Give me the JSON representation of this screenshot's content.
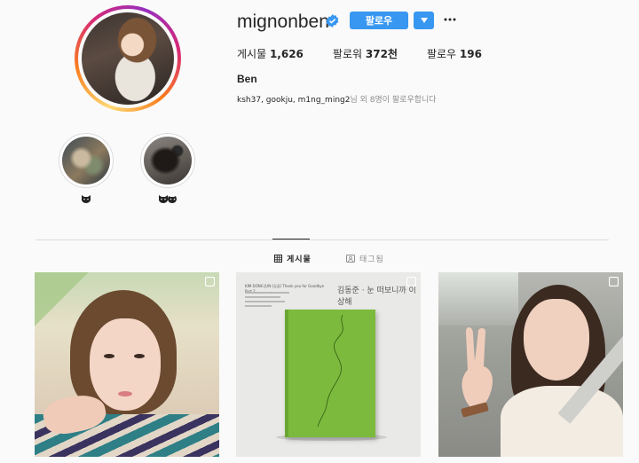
{
  "profile": {
    "username": "mignonben",
    "verified": true,
    "follow_label": "팔로우",
    "full_name": "Ben"
  },
  "stats": {
    "posts_label": "게시물",
    "posts_value": "1,626",
    "followers_label": "팔로워",
    "followers_value": "372천",
    "following_label": "팔로우",
    "following_value": "196"
  },
  "followed_by": {
    "names": "ksh37, gookju, m1ng_ming2",
    "suffix": "님 외 8명이 팔로우합니다"
  },
  "highlights": [
    {
      "label_icon": "cat-face-emoji"
    },
    {
      "label_icon": "cat-and-dog-face-emoji"
    }
  ],
  "tabs": {
    "posts_label": "게시물",
    "tagged_label": "태그됨"
  },
  "posts": [
    {
      "type": "photo",
      "multi": true
    },
    {
      "type": "album-cover",
      "multi": true,
      "small_text": "KIM DONG JUN  [싱글]  Thank you for Goodbye Part.2",
      "title_text": "김동준 · 눈 떠보니까 이상해"
    },
    {
      "type": "photo",
      "multi": true
    }
  ],
  "colors": {
    "accent": "#3897f0",
    "text": "#262626",
    "muted": "#8e8e8e",
    "border": "#dbdbdb",
    "background": "#fafafa"
  }
}
